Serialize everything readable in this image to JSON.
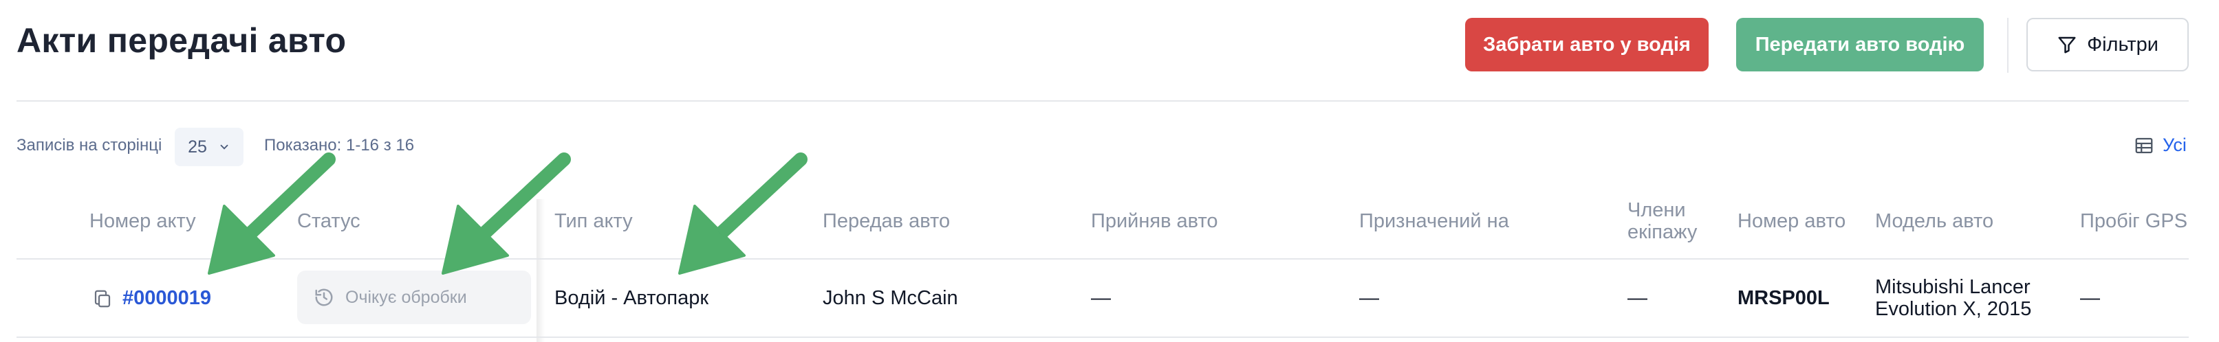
{
  "header": {
    "title": "Акти передачі авто",
    "take_car_label": "Забрати авто у водія",
    "give_car_label": "Передати авто водію",
    "filters_label": "Фільтри"
  },
  "toolbar": {
    "records_per_page_label": "Записів на сторінці",
    "page_size": "25",
    "shown_label": "Показано: 1-16 з 16",
    "columns_label": "Усі"
  },
  "table": {
    "columns": {
      "act_number": "Номер акту",
      "status": "Статус",
      "act_type": "Тип акту",
      "handed_over": "Передав авто",
      "received": "Прийняв авто",
      "assigned_to": "Призначений на",
      "crew_line1": "Члени",
      "crew_line2": "екіпажу",
      "car_number": "Номер авто",
      "car_model": "Модель авто",
      "gps_mileage": "Пробіг GPS"
    },
    "rows": [
      {
        "act_number": "#0000019",
        "status": "Очікує обробки",
        "act_type": "Водій - Автопарк",
        "handed_over": "John S McCain",
        "received": "—",
        "assigned_to": "—",
        "crew": "—",
        "car_number": "MRSP00L",
        "car_model_line1": "Mitsubishi Lancer",
        "car_model_line2": "Evolution X, 2015",
        "gps_mileage": "—"
      }
    ]
  },
  "colors": {
    "take_button": "#d94744",
    "give_button": "#5fb48b",
    "link": "#2a58d6",
    "annotation_arrow": "#4fae6a"
  },
  "icons": [
    "filter-icon",
    "chevron-down-icon",
    "columns-icon",
    "copy-icon",
    "history-icon"
  ]
}
